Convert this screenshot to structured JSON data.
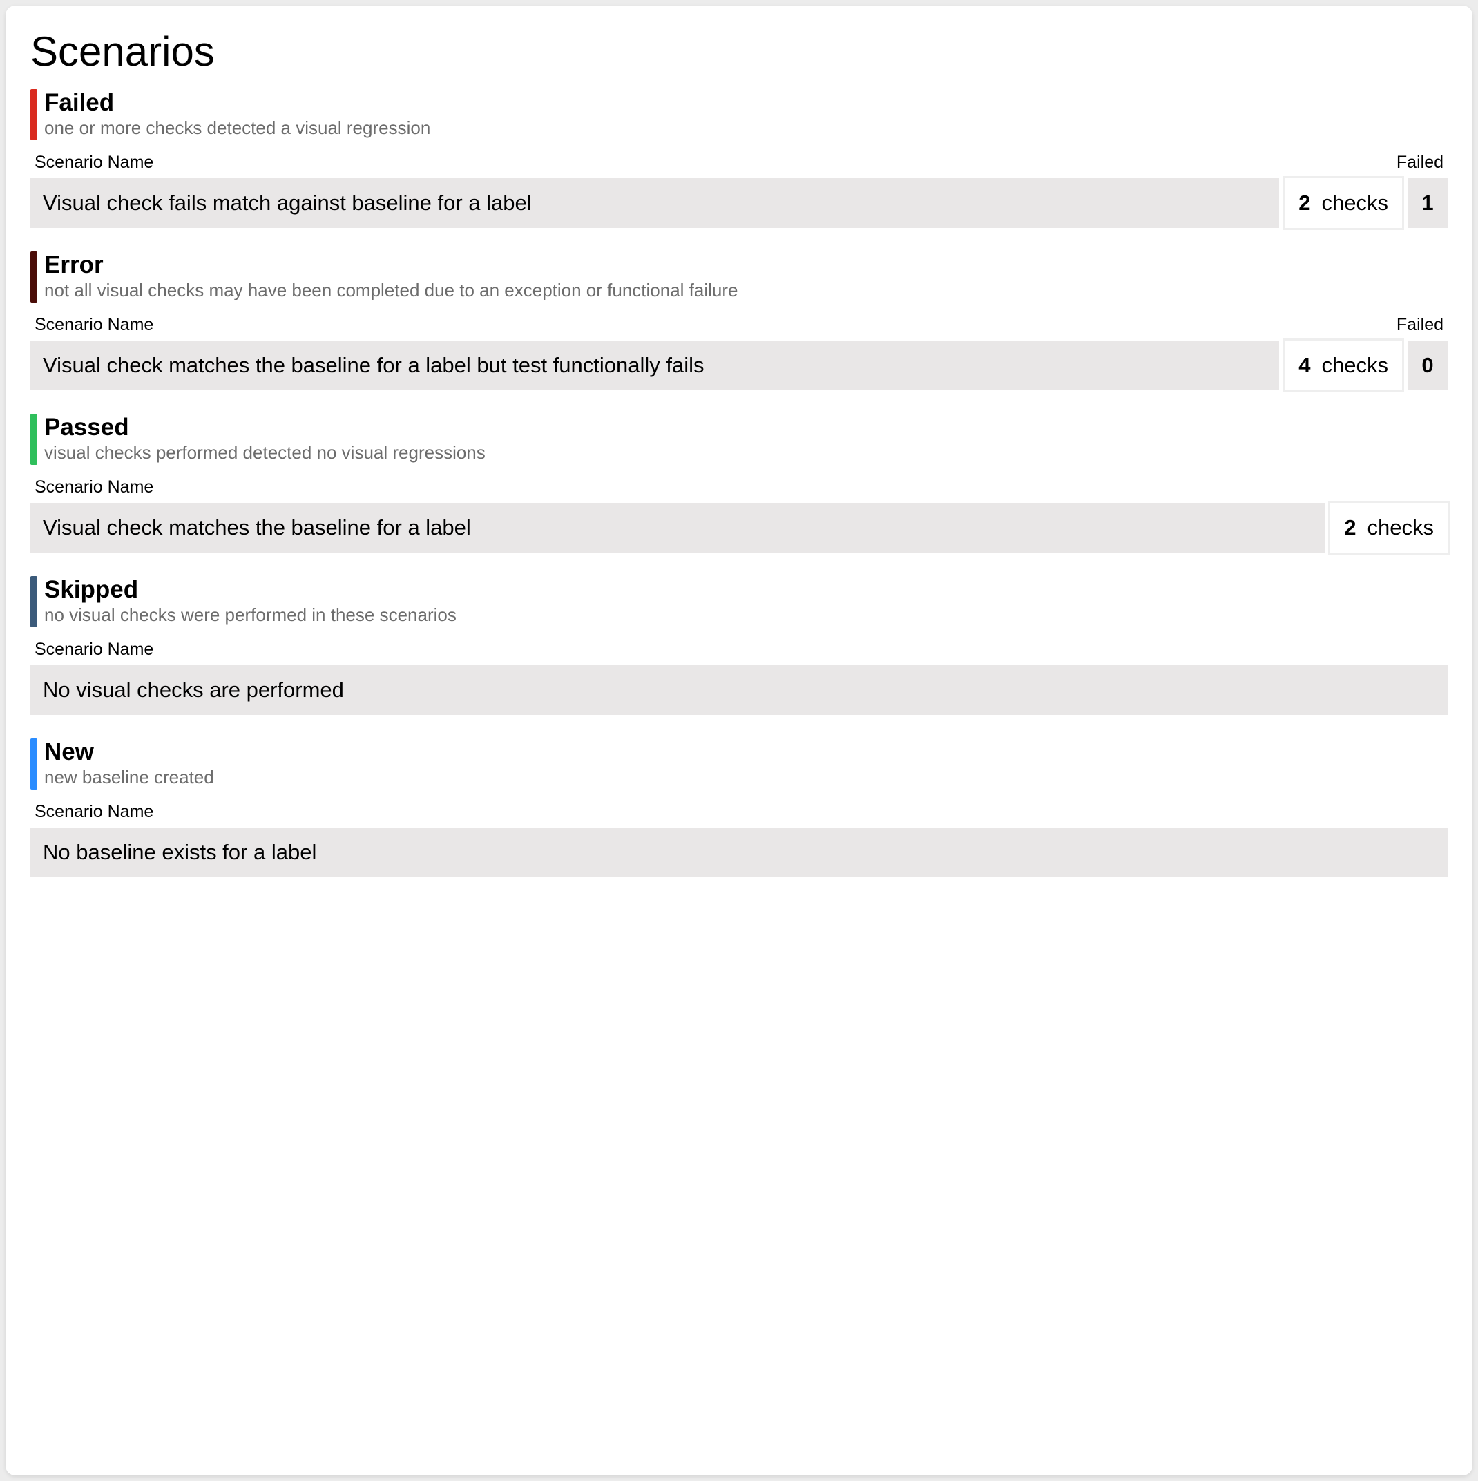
{
  "title": "Scenarios",
  "columns": {
    "name": "Scenario Name",
    "failed": "Failed",
    "checks_label": "checks"
  },
  "groups": [
    {
      "key": "failed",
      "heading": "Failed",
      "sub": "one or more checks detected a visual regression",
      "bar_class": "bar-failed",
      "show_failed_col": true,
      "rows": [
        {
          "name": "Visual check fails match against baseline for a label",
          "checks": 2,
          "failed": 1
        }
      ]
    },
    {
      "key": "error",
      "heading": "Error",
      "sub": "not all visual checks may have been completed due to an exception or functional failure",
      "bar_class": "bar-error",
      "show_failed_col": true,
      "rows": [
        {
          "name": "Visual check matches the baseline for a label but test functionally fails",
          "checks": 4,
          "failed": 0
        }
      ]
    },
    {
      "key": "passed",
      "heading": "Passed",
      "sub": "visual checks performed detected no visual regressions",
      "bar_class": "bar-passed",
      "show_failed_col": false,
      "rows": [
        {
          "name": "Visual check matches the baseline for a label",
          "checks": 2,
          "failed": null
        }
      ]
    },
    {
      "key": "skipped",
      "heading": "Skipped",
      "sub": "no visual checks were performed in these scenarios",
      "bar_class": "bar-skipped",
      "show_failed_col": false,
      "rows": [
        {
          "name": "No visual checks are performed",
          "checks": null,
          "failed": null
        }
      ]
    },
    {
      "key": "new",
      "heading": "New",
      "sub": "new baseline created",
      "bar_class": "bar-new",
      "show_failed_col": false,
      "rows": [
        {
          "name": "No baseline exists for a label",
          "checks": null,
          "failed": null
        }
      ]
    }
  ]
}
